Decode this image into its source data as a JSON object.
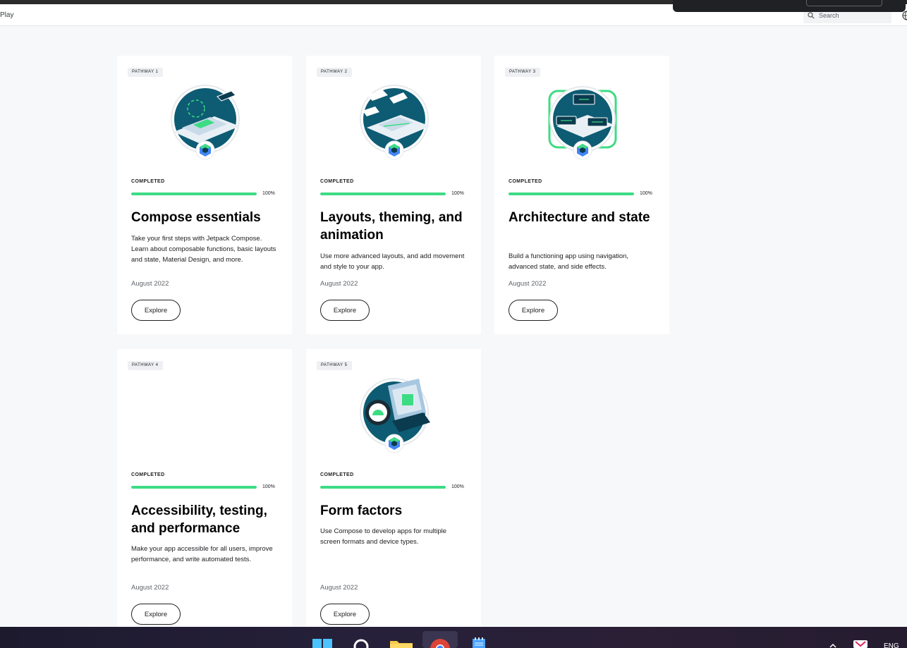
{
  "header": {
    "breadcrumb": "Play",
    "search_placeholder": "Search"
  },
  "cards": [
    {
      "badge": "PATHWAY 1",
      "status": "COMPLETED",
      "progress_percent": 100,
      "percent_label": "100%",
      "title": "Compose essentials",
      "description": "Take your first steps with Jetpack Compose. Learn about composable functions, basic layouts and state, Material Design, and more.",
      "date": "August 2022",
      "button": "Explore",
      "illustration": "compose-essentials-illustration"
    },
    {
      "badge": "PATHWAY 2",
      "status": "COMPLETED",
      "progress_percent": 100,
      "percent_label": "100%",
      "title": "Layouts, theming, and animation",
      "description": "Use more advanced layouts, and add movement and style to your app.",
      "date": "August 2022",
      "button": "Explore",
      "illustration": "layouts-theming-illustration"
    },
    {
      "badge": "PATHWAY 3",
      "status": "COMPLETED",
      "progress_percent": 100,
      "percent_label": "100%",
      "title": "Architecture and state",
      "description": "Build a functioning app using navigation, advanced state, and side effects.",
      "date": "August 2022",
      "button": "Explore",
      "illustration": "architecture-state-illustration"
    },
    {
      "badge": "PATHWAY 4",
      "status": "COMPLETED",
      "progress_percent": 100,
      "percent_label": "100%",
      "title": "Accessibility, testing, and performance",
      "description": "Make your app accessible for all users, improve performance, and write automated tests.",
      "date": "August 2022",
      "button": "Explore",
      "illustration": null
    },
    {
      "badge": "PATHWAY 5",
      "status": "COMPLETED",
      "progress_percent": 100,
      "percent_label": "100%",
      "title": "Form factors",
      "description": "Use Compose to develop apps for multiple screen formats and device types.",
      "date": "August 2022",
      "button": "Explore",
      "illustration": "form-factors-illustration"
    }
  ],
  "taskbar": {
    "icons": [
      "windows-start-icon",
      "search-icon",
      "file-explorer-icon",
      "chrome-icon",
      "notepad-icon"
    ],
    "tray_text": "ENG"
  },
  "colors": {
    "progress_fill": "#3ddc84",
    "card_background": "#ffffff",
    "page_background": "#f7f8fa",
    "illustration_teal": "#0d5c73"
  }
}
